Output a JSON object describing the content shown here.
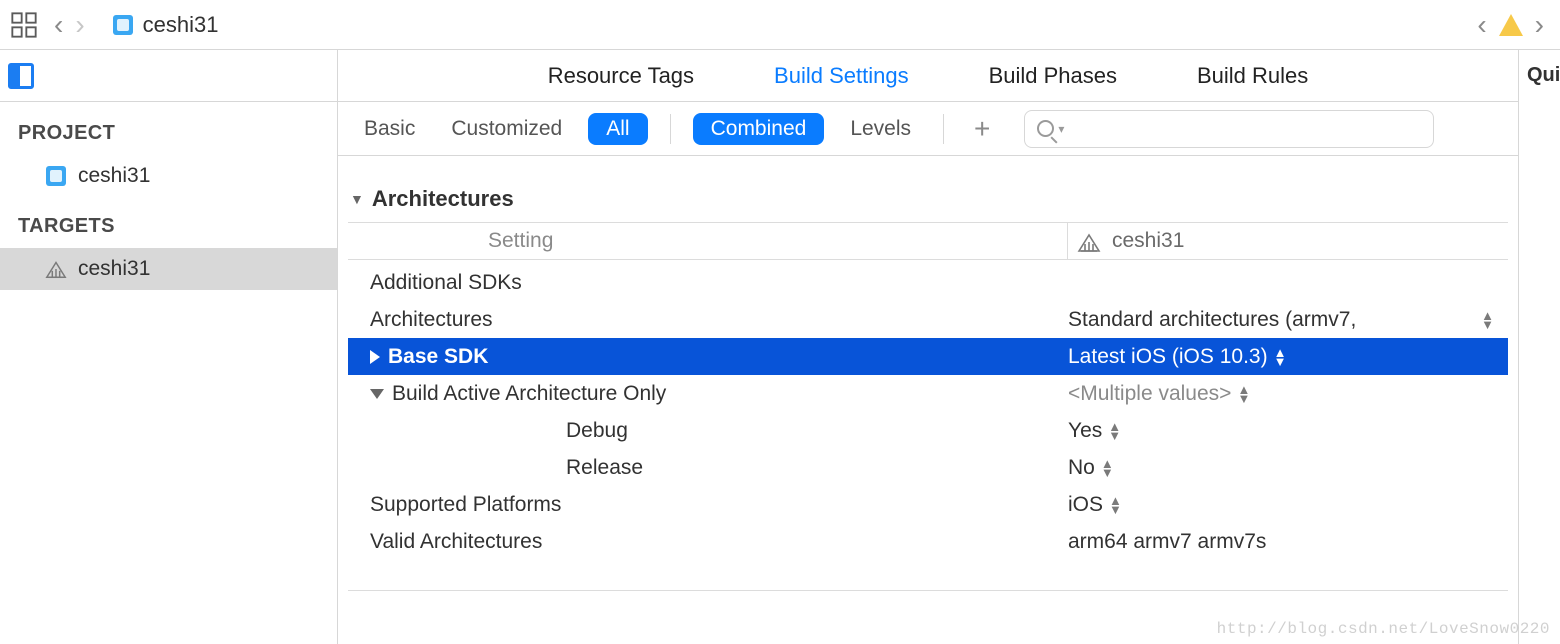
{
  "topbar": {
    "breadcrumb": "ceshi31"
  },
  "sidebar": {
    "project_label": "PROJECT",
    "targets_label": "TARGETS",
    "project_name": "ceshi31",
    "target_name": "ceshi31"
  },
  "tabs": {
    "resource_tags": "Resource Tags",
    "build_settings": "Build Settings",
    "build_phases": "Build Phases",
    "build_rules": "Build Rules"
  },
  "filter": {
    "basic": "Basic",
    "customized": "Customized",
    "all": "All",
    "combined": "Combined",
    "levels": "Levels",
    "search_placeholder": ""
  },
  "columns": {
    "setting": "Setting",
    "target": "ceshi31"
  },
  "section": {
    "title": "Architectures"
  },
  "rows": {
    "additional_sdks": {
      "name": "Additional SDKs",
      "value": ""
    },
    "architectures": {
      "name": "Architectures",
      "value": "Standard architectures (armv7,"
    },
    "base_sdk": {
      "name": "Base SDK",
      "value": "Latest iOS (iOS 10.3)"
    },
    "active_arch": {
      "name": "Build Active Architecture Only",
      "value": "<Multiple values>"
    },
    "debug": {
      "name": "Debug",
      "value": "Yes"
    },
    "release": {
      "name": "Release",
      "value": "No"
    },
    "supported": {
      "name": "Supported Platforms",
      "value": "iOS"
    },
    "valid": {
      "name": "Valid Architectures",
      "value": "arm64 armv7 armv7s"
    }
  },
  "right_strip": "Qui",
  "watermark": "http://blog.csdn.net/LoveSnow0220"
}
